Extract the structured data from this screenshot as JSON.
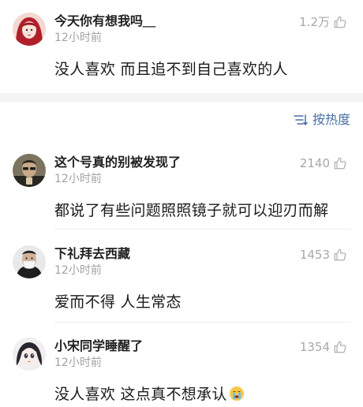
{
  "comments": [
    {
      "username": "今天你有想我吗＿",
      "time": "12小时前",
      "likes": "1.2万",
      "body": "没人喜欢  而且追不到自己喜欢的人"
    },
    {
      "username": "这个号真的别被发现了",
      "time": "12小时前",
      "likes": "2140",
      "body": "都说了有些问题照照镜子就可以迎刃而解"
    },
    {
      "username": "下礼拜去西藏",
      "time": "12小时前",
      "likes": "1453",
      "body": "爱而不得 人生常态"
    },
    {
      "username": "小宋同学睡醒了",
      "time": "12小时前",
      "likes": "1354",
      "body": "没人喜欢 这点真不想承认"
    }
  ],
  "sort": {
    "label": "按热度",
    "icon": "sort-icon"
  },
  "icons": {
    "like": "thumb-up-icon",
    "emoji": "crying-face-emoji"
  },
  "colors": {
    "accent": "#4a6fa5",
    "muted": "#a2a2a2",
    "divider": "#f4f4f4"
  }
}
